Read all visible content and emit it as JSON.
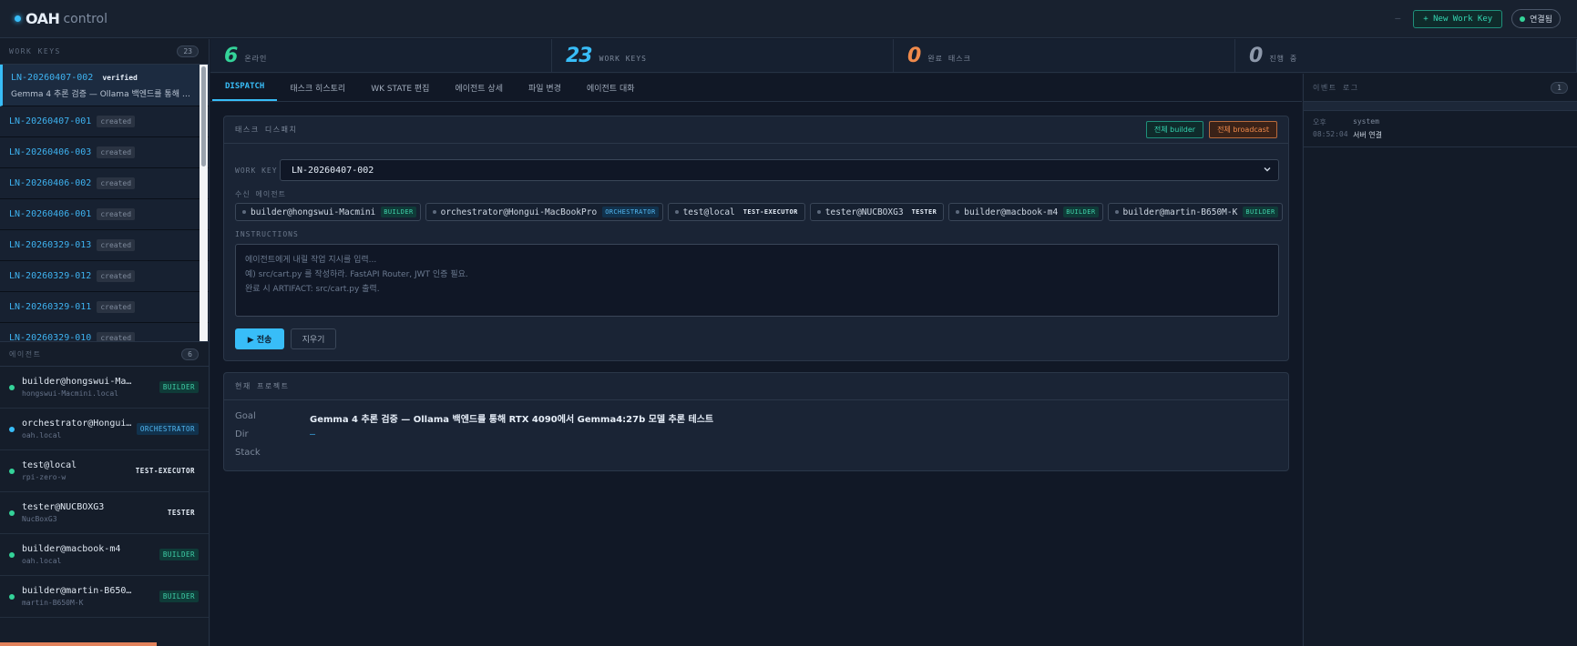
{
  "header": {
    "logo": "OAH",
    "logo_sub": "control",
    "dash": "—",
    "new_work_key": "+ New Work Key",
    "status": "연결됨"
  },
  "work_keys": {
    "title": "WORK KEYS",
    "count": "23",
    "items": [
      {
        "id": "LN-20260407-002",
        "status": "verified",
        "desc": "Gemma 4 추론 검증 — Ollama 백엔드를 통해 RTX 4090에서 Gemma4:27b 모델 추론 테스트"
      },
      {
        "id": "LN-20260407-001",
        "status": "created"
      },
      {
        "id": "LN-20260406-003",
        "status": "created"
      },
      {
        "id": "LN-20260406-002",
        "status": "created"
      },
      {
        "id": "LN-20260406-001",
        "status": "created"
      },
      {
        "id": "LN-20260329-013",
        "status": "created"
      },
      {
        "id": "LN-20260329-012",
        "status": "created"
      },
      {
        "id": "LN-20260329-011",
        "status": "created"
      },
      {
        "id": "LN-20260329-010",
        "status": "created"
      }
    ]
  },
  "agents": {
    "title": "에이전트",
    "count": "6",
    "items": [
      {
        "name": "builder@hongswui-Macmini",
        "host": "hongswui-Macmini.local",
        "role": "BUILDER",
        "dot": "#34d399"
      },
      {
        "name": "orchestrator@Hongui-MacBookPro",
        "host": "oah.local",
        "role": "ORCHESTRATOR",
        "dot": "#38bdf8"
      },
      {
        "name": "test@local",
        "host": "rpi-zero-w",
        "role": "TEST-EXECUTOR",
        "dot": "#34d399"
      },
      {
        "name": "tester@NUCBOXG3",
        "host": "NucBoxG3",
        "role": "TESTER",
        "dot": "#34d399"
      },
      {
        "name": "builder@macbook-m4",
        "host": "oah.local",
        "role": "BUILDER",
        "dot": "#34d399"
      },
      {
        "name": "builder@martin-B650M-K",
        "host": "martin-B650M-K",
        "role": "BUILDER",
        "dot": "#34d399"
      }
    ]
  },
  "stats": [
    {
      "num": "6",
      "label": "온라인",
      "color": "#34d399"
    },
    {
      "num": "23",
      "label": "WORK KEYS",
      "color": "#38bdf8"
    },
    {
      "num": "0",
      "label": "완료 태스크",
      "color": "#f08a4b"
    },
    {
      "num": "0",
      "label": "진행 중",
      "color": "#8e99ab"
    }
  ],
  "tabs": [
    "DISPATCH",
    "태스크 히스토리",
    "WK STATE 편집",
    "에이전트 상세",
    "파일 변경",
    "에이전트 대화"
  ],
  "dispatch": {
    "title": "태스크 디스패치",
    "all_builder": "전체 builder",
    "all_broadcast": "전체 broadcast",
    "wk_label": "WORK KEY",
    "wk_value": "LN-20260407-002",
    "recv_label": "수신 에이전트",
    "recipients": [
      {
        "name": "builder@hongswui-Macmini",
        "role": "BUILDER"
      },
      {
        "name": "orchestrator@Hongui-MacBookPro",
        "role": "ORCHESTRATOR"
      },
      {
        "name": "test@local",
        "role": "TEST-EXECUTOR"
      },
      {
        "name": "tester@NUCBOXG3",
        "role": "TESTER"
      },
      {
        "name": "builder@macbook-m4",
        "role": "BUILDER"
      },
      {
        "name": "builder@martin-B650M-K",
        "role": "BUILDER"
      }
    ],
    "instr_label": "INSTRUCTIONS",
    "instr_placeholder": "에이전트에게 내릴 작업 지시를 입력...\n예) src/cart.py 를 작성하라. FastAPI Router, JWT 인증 필요.\n완료 시 ARTIFACT: src/cart.py 출력.",
    "send": "▶ 전송",
    "clear": "지우기"
  },
  "project": {
    "title": "현재 프로젝트",
    "goal_key": "Goal",
    "goal_val": "Gemma 4 추론 검증 — Ollama 백엔드를 통해 RTX 4090에서 Gemma4:27b 모델 추론 테스트",
    "dir_key": "Dir",
    "dir_val": "—",
    "stack_key": "Stack"
  },
  "event_log": {
    "title": "이벤트 로그",
    "count": "1",
    "entries": [
      {
        "period": "오후",
        "source": "system",
        "time": "08:52:04",
        "msg": "서버 연결"
      }
    ]
  }
}
